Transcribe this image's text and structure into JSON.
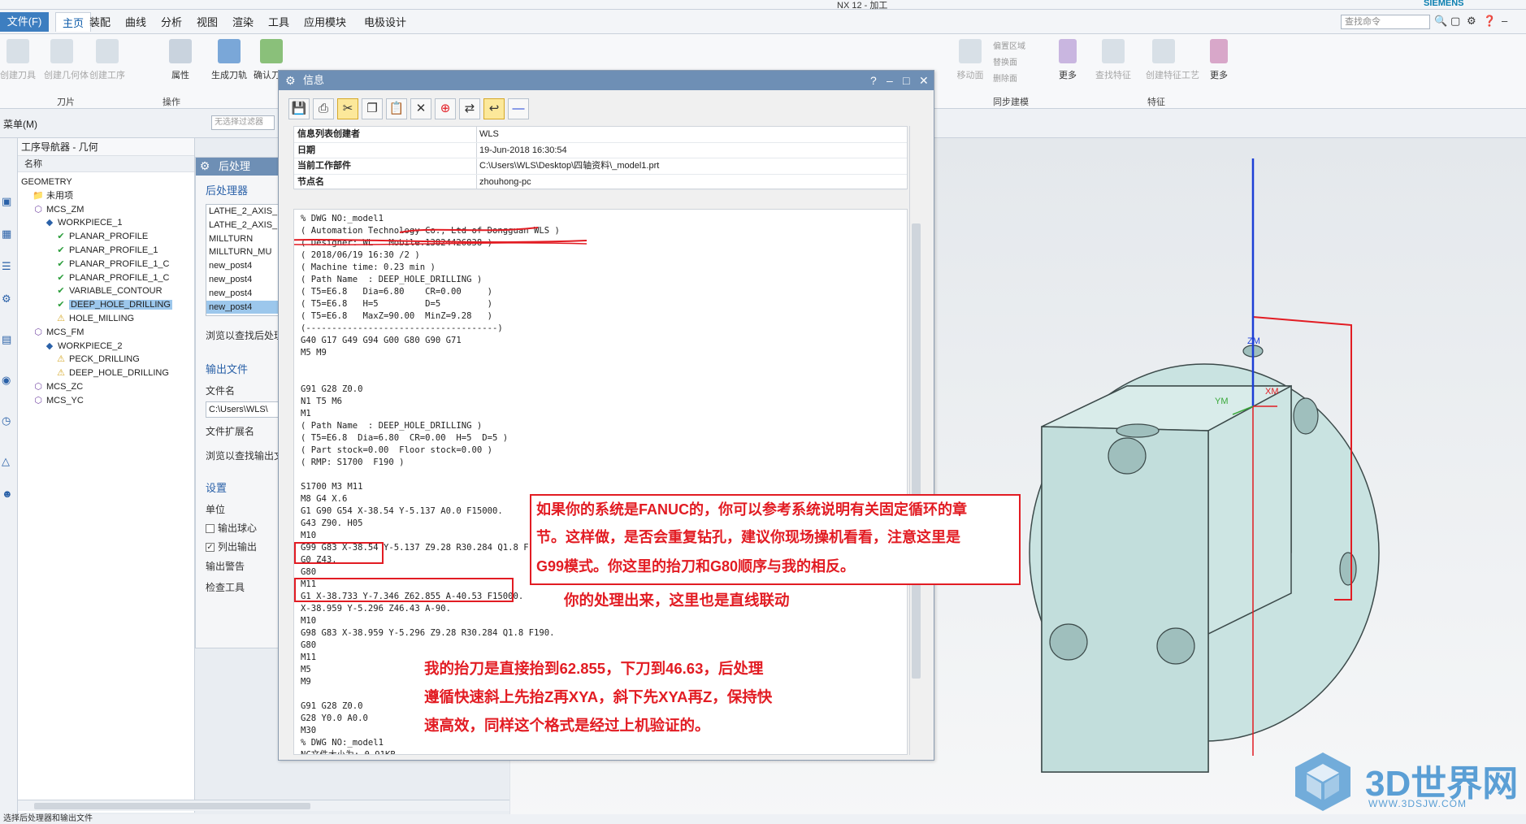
{
  "window": {
    "title": "NX 12 - 加工",
    "brand": "SIEMENS"
  },
  "menu": {
    "file": "文件(F)",
    "tabs": [
      "主页",
      "装配",
      "曲线",
      "分析",
      "视图",
      "渲染",
      "工具",
      "应用模块",
      "电极设计"
    ],
    "search_placeholder": "查找命令"
  },
  "ribbon": {
    "buttons": [
      "属性",
      "生成刀轨",
      "确认刀轨",
      "更多",
      "更多"
    ],
    "dim_buttons": [
      "创建刀具",
      "创建几何体",
      "创建工序",
      "移动面",
      "查找特征",
      "创建特征工艺"
    ],
    "small": [
      "偏置区域",
      "替换面",
      "删除面"
    ],
    "groups": [
      "刀片",
      "操作",
      "同步建模",
      "特征"
    ]
  },
  "subbar": {
    "menu": "菜单(M)",
    "filter": "无选择过滤器"
  },
  "navigator": {
    "title": "工序导航器 - 几何",
    "column": "名称",
    "tree": [
      {
        "label": "GEOMETRY",
        "icon": "",
        "selected": false
      },
      {
        "label": "未用项",
        "icon": "folder-icon",
        "selected": false
      },
      {
        "label": "MCS_ZM",
        "icon": "mcs-icon",
        "selected": false
      },
      {
        "label": "WORKPIECE_1",
        "icon": "workpiece-icon",
        "selected": false
      },
      {
        "label": "PLANAR_PROFILE",
        "icon": "operation-ok-icon",
        "selected": false
      },
      {
        "label": "PLANAR_PROFILE_1",
        "icon": "operation-ok-icon",
        "selected": false
      },
      {
        "label": "PLANAR_PROFILE_1_C",
        "icon": "operation-ok-icon",
        "selected": false
      },
      {
        "label": "PLANAR_PROFILE_1_C",
        "icon": "operation-ok-icon",
        "selected": false
      },
      {
        "label": "VARIABLE_CONTOUR",
        "icon": "operation-ok-icon",
        "selected": false
      },
      {
        "label": "DEEP_HOLE_DRILLING",
        "icon": "operation-ok-icon",
        "selected": true
      },
      {
        "label": "HOLE_MILLING",
        "icon": "operation-warn-icon",
        "selected": false
      },
      {
        "label": "MCS_FM",
        "icon": "mcs-icon",
        "selected": false
      },
      {
        "label": "WORKPIECE_2",
        "icon": "workpiece-icon",
        "selected": false
      },
      {
        "label": "PECK_DRILLING",
        "icon": "operation-warn-icon",
        "selected": false
      },
      {
        "label": "DEEP_HOLE_DRILLING",
        "icon": "operation-warn-icon",
        "selected": false
      },
      {
        "label": "MCS_ZC",
        "icon": "mcs-icon",
        "selected": false
      },
      {
        "label": "MCS_YC",
        "icon": "mcs-icon",
        "selected": false
      }
    ]
  },
  "postprocess": {
    "title": "后处理",
    "section_post": "后处理器",
    "posts": [
      "LATHE_2_AXIS_",
      "LATHE_2_AXIS_",
      "MILLTURN",
      "MILLTURN_MU",
      "new_post4",
      "new_post4",
      "new_post4",
      "new_post4"
    ],
    "browse_post": "浏览以查找后处理",
    "section_output": "输出文件",
    "file_name_label": "文件名",
    "file_name": "C:\\Users\\WLS\\",
    "file_ext_label": "文件扩展名",
    "browse_output": "浏览以查找输出文",
    "section_settings": "设置",
    "unit": "单位",
    "output_ball": "输出球心",
    "list_output": "列出输出",
    "output_warning": "输出警告",
    "check_tool": "检查工具"
  },
  "info": {
    "title": "信息",
    "meta": [
      {
        "k": "信息列表创建者",
        "v": "WLS"
      },
      {
        "k": "日期",
        "v": "19-Jun-2018 16:30:54"
      },
      {
        "k": "当前工作部件",
        "v": "C:\\Users\\WLS\\Desktop\\四轴资料\\_model1.prt"
      },
      {
        "k": "节点名",
        "v": "zhouhong-pc"
      }
    ],
    "code": "% DWG NO:_model1\n( Automation Technology Co., Ltd of Dongguan WLS )\n( Designer: WL   Mobile:13824426838 )\n( 2018/06/19 16:30 /2 )\n( Machine time: 0.23 min )\n( Path Name  : DEEP_HOLE_DRILLING )\n( T5=E6.8   Dia=6.80    CR=0.00     )\n( T5=E6.8   H=5         D=5         )\n( T5=E6.8   MaxZ=90.00  MinZ=9.28   )\n(-------------------------------------)\nG40 G17 G49 G94 G00 G80 G90 G71\nM5 M9\n\n\nG91 G28 Z0.0\nN1 T5 M6\nM1\n( Path Name  : DEEP_HOLE_DRILLING )\n( T5=E6.8  Dia=6.80  CR=0.00  H=5  D=5 )\n( Part stock=0.00  Floor stock=0.00 )\n( RMP: S1700  F190 )\n\nS1700 M3 M11\nM8 G4 X.6\nG1 G90 G54 X-38.54 Y-5.137 A0.0 F15000.\nG43 Z90. H05\nM10\nG99 G83 X-38.54 Y-5.137 Z9.28 R30.284 Q1.8 F190.\nG0 Z43.\nG80\nM11\nG1 X-38.733 Y-7.346 Z62.855 A-40.53 F15000.\nX-38.959 Y-5.296 Z46.43 A-90.\nM10\nG98 G83 X-38.959 Y-5.296 Z9.28 R30.284 Q1.8 F190.\nG80\nM11\nM5\nM9\n\nG91 G28 Z0.0\nG28 Y0.0 A0.0\nM30\n% DWG NO:_model1\nNC文件大小为: 0.91KB"
  },
  "annotations": {
    "note1_line1": "如果你的系统是FANUC的，你可以参考系统说明有关固定循环的章",
    "note1_line2": "节。这样做，是否会重复钻孔，建议你现场操机看看，注意这里是",
    "note1_line3": "G99模式。你这里的抬刀和G80顺序与我的相反。",
    "note2": "你的处理出来，这里也是直线联动",
    "note3_line1": "我的抬刀是直接抬到62.855，下刀到46.63，后处理",
    "note3_line2": "遵循快速斜上先抬Z再XYA，斜下先XYA再Z，保持快",
    "note3_line3": "速高效，同样这个格式是经过上机验证的。"
  },
  "viewport": {
    "axis_zm": "ZM",
    "axis_xm": "XM",
    "axis_ym": "YM"
  },
  "watermark": {
    "brand": "3D世界网",
    "url": "WWW.3DSJW.COM"
  },
  "status": "选择后处理器和输出文件",
  "colors": {
    "accent": "#3d7ec0",
    "title": "#6e8fb5",
    "annotation": "#e21c23",
    "model": "#c9e3e1"
  }
}
